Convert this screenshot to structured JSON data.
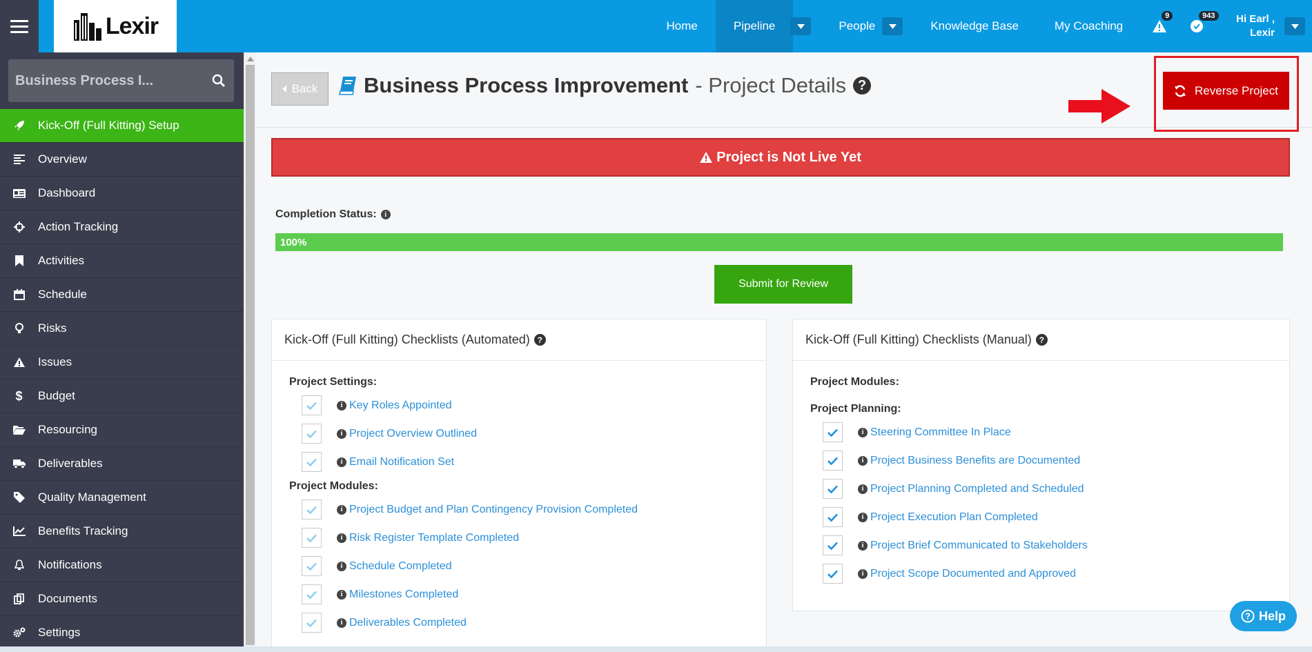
{
  "topbar": {
    "logo_text": "Lexir",
    "nav": [
      {
        "label": "Home"
      },
      {
        "label": "Pipeline"
      },
      {
        "label": "People"
      },
      {
        "label": "Knowledge Base"
      },
      {
        "label": "My Coaching"
      }
    ],
    "alerts_count": "9",
    "tasks_count": "943",
    "user_greeting": "Hi Earl ,",
    "user_org": "Lexir"
  },
  "sidebar": {
    "search_value": "Business Process I...",
    "items": [
      {
        "label": "Kick-Off (Full Kitting) Setup",
        "icon": "rocket-icon"
      },
      {
        "label": "Overview",
        "icon": "align-left-icon"
      },
      {
        "label": "Dashboard",
        "icon": "id-card-icon"
      },
      {
        "label": "Action Tracking",
        "icon": "crosshairs-icon"
      },
      {
        "label": "Activities",
        "icon": "bookmark-icon"
      },
      {
        "label": "Schedule",
        "icon": "calendar-icon"
      },
      {
        "label": "Risks",
        "icon": "lightbulb-icon"
      },
      {
        "label": "Issues",
        "icon": "warning-icon"
      },
      {
        "label": "Budget",
        "icon": "dollar-icon"
      },
      {
        "label": "Resourcing",
        "icon": "folder-open-icon"
      },
      {
        "label": "Deliverables",
        "icon": "truck-icon"
      },
      {
        "label": "Quality Management",
        "icon": "tag-icon"
      },
      {
        "label": "Benefits Tracking",
        "icon": "line-chart-icon"
      },
      {
        "label": "Notifications",
        "icon": "bell-icon"
      },
      {
        "label": "Documents",
        "icon": "copy-icon"
      },
      {
        "label": "Settings",
        "icon": "cogs-icon"
      }
    ]
  },
  "header": {
    "back_label": "Back",
    "title_main": "Business Process Improvement",
    "title_sub": "- Project Details",
    "reverse_label": "Reverse Project"
  },
  "alert_text": "Project is Not Live Yet",
  "completion": {
    "label": "Completion Status:",
    "percent_label": "100%",
    "percent_value": 100
  },
  "submit_label": "Submit for Review",
  "automated": {
    "title": "Kick-Off (Full Kitting) Checklists (Automated)",
    "settings_heading": "Project Settings:",
    "settings_items": [
      "Key Roles Appointed",
      "Project Overview Outlined",
      "Email Notification Set"
    ],
    "modules_heading": "Project Modules:",
    "modules_items": [
      "Project Budget and Plan Contingency Provision Completed",
      "Risk Register Template Completed",
      "Schedule Completed",
      "Milestones Completed",
      "Deliverables Completed"
    ]
  },
  "manual": {
    "title": "Kick-Off (Full Kitting) Checklists (Manual)",
    "modules_heading": "Project Modules:",
    "planning_heading": "Project Planning:",
    "planning_items": [
      "Steering Committee In Place",
      "Project Business Benefits are Documented",
      "Project Planning Completed and Scheduled",
      "Project Execution Plan Completed",
      "Project Brief Communicated to Stakeholders",
      "Project Scope Documented and Approved"
    ]
  },
  "help_label": "Help",
  "colors": {
    "topbar": "#0a9ae2",
    "sidebar": "#3a3d4d",
    "active_menu": "#3cb516",
    "alert": "#e04040",
    "reverse": "#cc0000",
    "progress": "#5ccc4e",
    "submit": "#36a50f"
  }
}
